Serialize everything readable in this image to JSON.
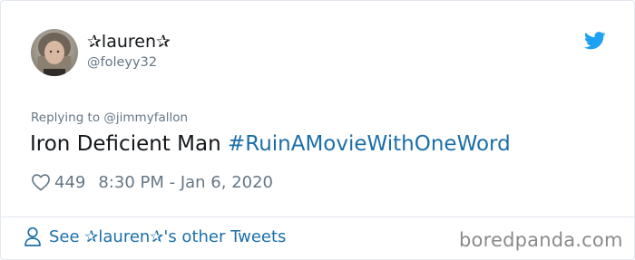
{
  "tweet": {
    "display_name": "✰lauren✰",
    "handle": "@foleyy32",
    "replying_to": "Replying to @jimmyfallon",
    "text": "Iron Deficient Man",
    "hashtag": "#RuinAMovieWithOneWord",
    "likes": "449",
    "timestamp": "8:30 PM - Jan 6, 2020"
  },
  "footer": {
    "see_more_label": "See ✰lauren✰'s other Tweets"
  },
  "watermark": "boredpanda.com",
  "colors": {
    "twitter_blue": "#1da1f2",
    "link_blue": "#1b6fa8",
    "secondary_text": "#657786",
    "border": "#e1e8ed"
  },
  "icons": {
    "bird": "twitter-bird-icon",
    "heart": "heart-icon",
    "person": "person-icon"
  }
}
